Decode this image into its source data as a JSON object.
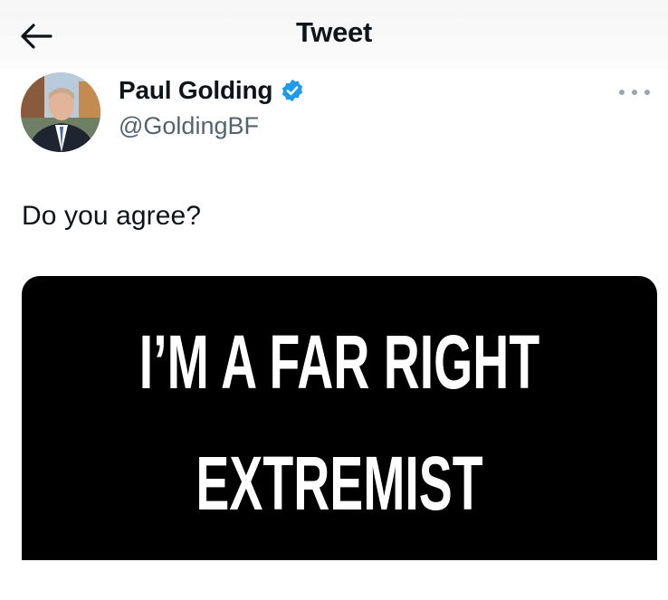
{
  "header": {
    "title": "Tweet",
    "back_icon": "arrow-left-icon"
  },
  "author": {
    "display_name": "Paul Golding",
    "handle": "@GoldingBF",
    "verified": true,
    "verified_color": "#1d9bf0",
    "more_icon": "more-horizontal-icon"
  },
  "tweet": {
    "text": "Do you agree?",
    "media": {
      "line1": "I’M A FAR RIGHT",
      "line2": "EXTREMIST",
      "background": "#000000",
      "text_color": "#ffffff"
    }
  }
}
